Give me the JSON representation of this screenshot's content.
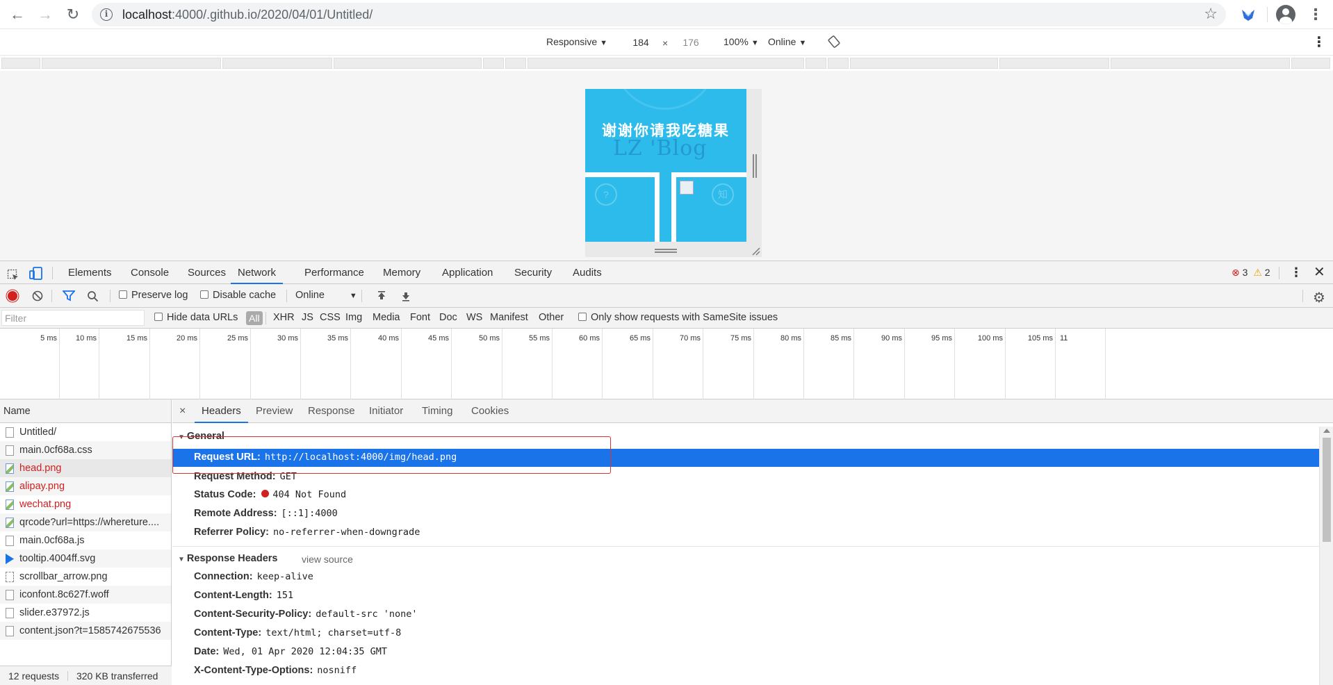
{
  "browser": {
    "url_prefix": "localhost",
    "url_rest": ":4000/.github.io/2020/04/01/Untitled/",
    "back_icon": "←",
    "forward_icon": "→",
    "reload_icon": "↻",
    "bookmark_icon": "☆"
  },
  "device_toolbar": {
    "device": "Responsive",
    "width": "184",
    "times": "×",
    "height": "176",
    "zoom": "100%",
    "throttle": "Online"
  },
  "page": {
    "thanks": "谢谢你请我吃糖果",
    "watermark": "LZ 'Blog",
    "ghost1": "?",
    "ghost2": "知"
  },
  "devtools": {
    "tabs": [
      "Elements",
      "Console",
      "Sources",
      "Network",
      "Performance",
      "Memory",
      "Application",
      "Security",
      "Audits"
    ],
    "active_tab": "Network",
    "errors": "3",
    "warnings": "2",
    "toolbar": {
      "preserve_log": "Preserve log",
      "disable_cache": "Disable cache",
      "throttle": "Online"
    },
    "filter": {
      "placeholder": "Filter",
      "hide_data_urls": "Hide data URLs",
      "types": [
        "All",
        "XHR",
        "JS",
        "CSS",
        "Img",
        "Media",
        "Font",
        "Doc",
        "WS",
        "Manifest",
        "Other"
      ],
      "samesite": "Only show requests with SameSite issues"
    },
    "timeline_ticks": [
      "5 ms",
      "10 ms",
      "15 ms",
      "20 ms",
      "25 ms",
      "30 ms",
      "35 ms",
      "40 ms",
      "45 ms",
      "50 ms",
      "55 ms",
      "60 ms",
      "65 ms",
      "70 ms",
      "75 ms",
      "80 ms",
      "85 ms",
      "90 ms",
      "95 ms",
      "100 ms",
      "105 ms",
      "11"
    ],
    "requests": {
      "header": "Name",
      "items": [
        {
          "name": "Untitled/",
          "kind": "doc",
          "error": false
        },
        {
          "name": "main.0cf68a.css",
          "kind": "doc",
          "error": false
        },
        {
          "name": "head.png",
          "kind": "img",
          "error": true
        },
        {
          "name": "alipay.png",
          "kind": "img",
          "error": true
        },
        {
          "name": "wechat.png",
          "kind": "img",
          "error": true
        },
        {
          "name": "qrcode?url=https://whereture....",
          "kind": "img",
          "error": false
        },
        {
          "name": "main.0cf68a.js",
          "kind": "doc",
          "error": false
        },
        {
          "name": "tooltip.4004ff.svg",
          "kind": "svg",
          "error": false
        },
        {
          "name": "scrollbar_arrow.png",
          "kind": "dots",
          "error": false
        },
        {
          "name": "iconfont.8c627f.woff",
          "kind": "doc",
          "error": false
        },
        {
          "name": "slider.e37972.js",
          "kind": "doc",
          "error": false
        },
        {
          "name": "content.json?t=1585742675536",
          "kind": "doc",
          "error": false
        }
      ],
      "summary_count": "12 requests",
      "summary_size": "320 KB transferred"
    },
    "details": {
      "close": "×",
      "tabs": [
        "Headers",
        "Preview",
        "Response",
        "Initiator",
        "Timing",
        "Cookies"
      ],
      "active_tab": "Headers",
      "general_title": "General",
      "general": {
        "request_url_key": "Request URL:",
        "request_url": "http://localhost:4000/img/head.png",
        "method_key": "Request Method:",
        "method": "GET",
        "status_key": "Status Code:",
        "status": "404 Not Found",
        "remote_key": "Remote Address:",
        "remote": "[::1]:4000",
        "referrer_key": "Referrer Policy:",
        "referrer": "no-referrer-when-downgrade"
      },
      "response_title": "Response Headers",
      "view_source": "view source",
      "response": [
        {
          "k": "Connection:",
          "v": "keep-alive"
        },
        {
          "k": "Content-Length:",
          "v": "151"
        },
        {
          "k": "Content-Security-Policy:",
          "v": "default-src 'none'"
        },
        {
          "k": "Content-Type:",
          "v": "text/html; charset=utf-8"
        },
        {
          "k": "Date:",
          "v": "Wed, 01 Apr 2020 12:04:35 GMT"
        },
        {
          "k": "X-Content-Type-Options:",
          "v": "nosniff"
        }
      ]
    }
  },
  "colors": {
    "accent": "#1a73e8",
    "error": "#d21f1f",
    "page_bg": "#2dbbec"
  }
}
